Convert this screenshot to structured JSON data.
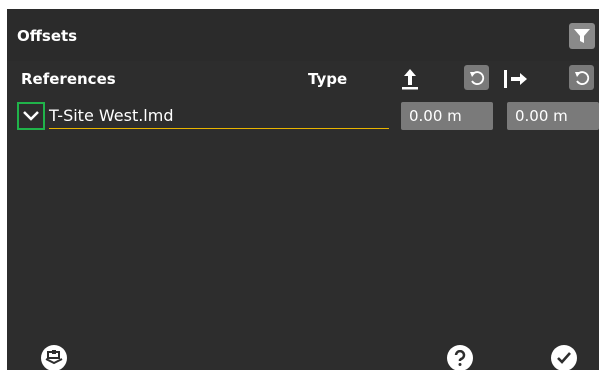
{
  "header": {
    "title": "Offsets"
  },
  "columns": {
    "references": "References",
    "type": "Type"
  },
  "row": {
    "reference_name": "T-Site West.lmd",
    "vertical_offset": "0.00 m",
    "horizontal_offset": "0.00 m"
  },
  "icons": {
    "filter": "filter-icon",
    "vertical_offset": "arrow-up-icon",
    "horizontal_offset": "arrow-right-icon",
    "reset": "undo-icon",
    "expand": "chevron-down-icon",
    "layers": "layers-icon",
    "help": "question-icon",
    "confirm": "check-icon"
  },
  "colors": {
    "background": "#2d2d2d",
    "accent_underline": "#e8b400",
    "selection_border": "#20b34a",
    "field_bg": "#7a7a7a"
  }
}
